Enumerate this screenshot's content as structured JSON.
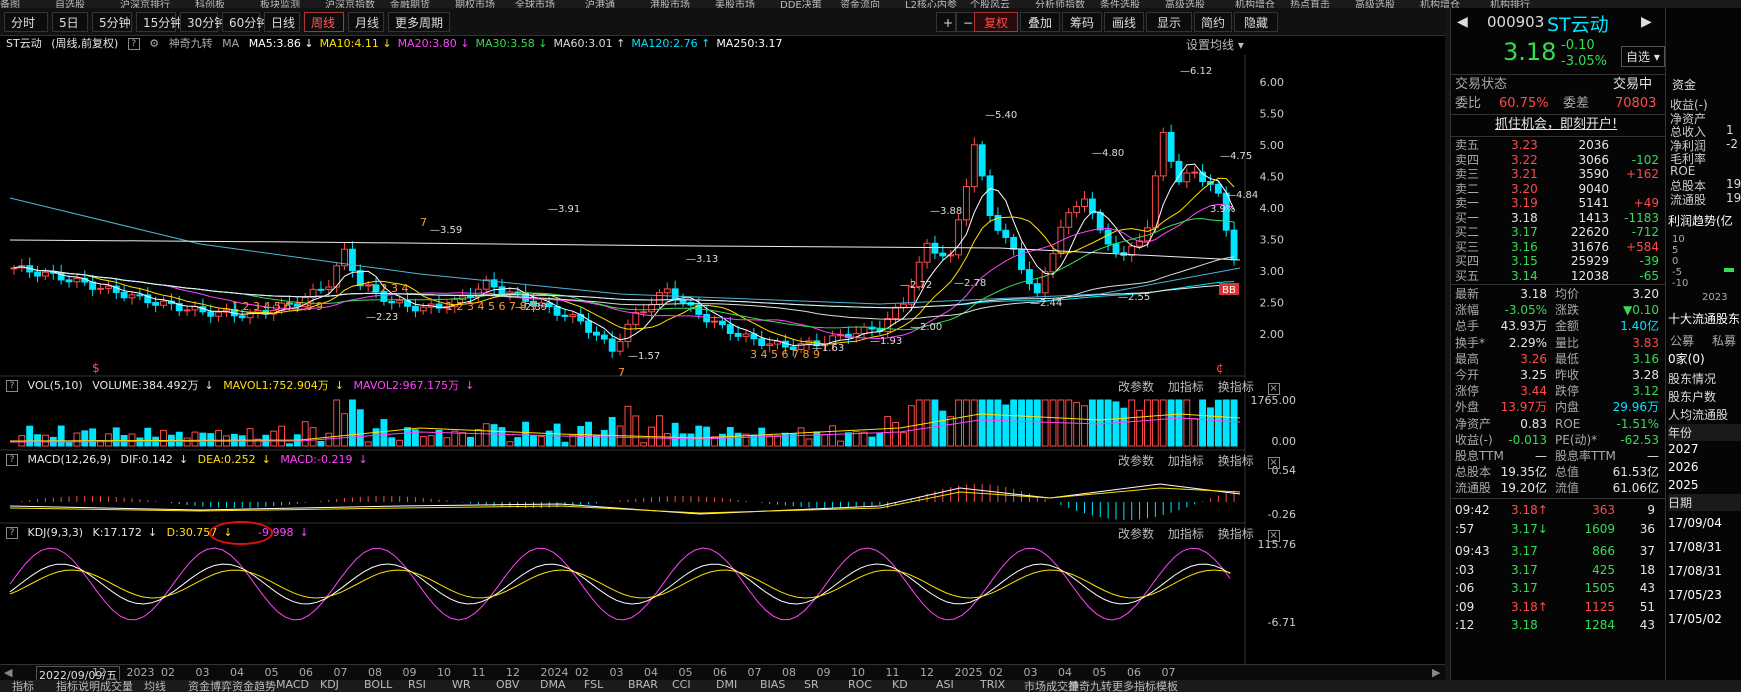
{
  "menubar": [
    "备图",
    "自选股",
    "沪深京排行",
    "科创板",
    "板块监测",
    "沪深京指数",
    "金融期货",
    "期权市场",
    "全球市场",
    "沪港通",
    "港股市场",
    "美股市场",
    "DDE决策",
    "资金流向",
    "L2核心内参",
    "个股风云",
    "分析师指数",
    "条件选股",
    "高级选股",
    "机构增仓",
    "热点直击",
    "高级选股",
    "机构增仓",
    "机构排行"
  ],
  "toolbar": {
    "periods": [
      "分时",
      "5日",
      "5分钟",
      "15分钟",
      "30分钟",
      "60分钟",
      "日线",
      "周线",
      "月线",
      "更多周期"
    ],
    "active_period": "周线",
    "right_buttons": [
      "+",
      "−",
      "复权",
      "叠加",
      "筹码",
      "画线",
      "显示",
      "简约",
      "隐藏"
    ]
  },
  "main_chart": {
    "stock_label": "ST云动",
    "mode_label": "(周线,前复权)",
    "indicator_label": "神奇九转",
    "ma_title": "MA",
    "ma": [
      {
        "label": "MA5:3.86",
        "color": "#ffffff",
        "dir": "↓"
      },
      {
        "label": "MA10:4.11",
        "color": "#ffe000",
        "dir": "↓"
      },
      {
        "label": "MA20:3.80",
        "color": "#ff44ff",
        "dir": "↓"
      },
      {
        "label": "MA30:3.58",
        "color": "#33dd55",
        "dir": "↓"
      },
      {
        "label": "MA60:3.01",
        "color": "#dddddd",
        "dir": "↑"
      },
      {
        "label": "MA120:2.76",
        "color": "#00e5ff",
        "dir": "↑"
      },
      {
        "label": "MA250:3.17",
        "color": "#ffffff",
        "dir": ""
      }
    ],
    "settings_label": "设置均线",
    "y_ticks": [
      "6.00",
      "5.50",
      "5.00",
      "4.50",
      "4.00",
      "3.50",
      "3.00",
      "2.50",
      "2.00"
    ],
    "price_tags": [
      "6.12",
      "5.40",
      "4.80",
      "4.75",
      "3.91",
      "3.88",
      "3.59",
      "3.13",
      "2.78",
      "2.72",
      "2.55",
      "2.44",
      "2.39",
      "2.23",
      "2.00",
      "1.93",
      "1.63",
      "1.57"
    ],
    "right_small_labels": [
      "4.84",
      "3.9%"
    ],
    "bb_badge": "BB",
    "markers": [
      "$",
      "¢"
    ]
  },
  "vol_panel": {
    "title": "VOL(5,10)",
    "volume": "VOLUME:384.492万",
    "mavol1": "MAVOL1:752.904万",
    "mavol2": "MAVOL2:967.175万",
    "y_top": "1765.00",
    "y_bottom": "0.00",
    "controls": [
      "改参数",
      "加指标",
      "换指标"
    ]
  },
  "macd_panel": {
    "title": "MACD(12,26,9)",
    "dif": "DIF:0.142",
    "dea": "DEA:0.252",
    "macd": "MACD:-0.219",
    "y_top": "0.54",
    "y_bottom": "-0.26",
    "controls": [
      "改参数",
      "加指标",
      "换指标"
    ]
  },
  "kdj_panel": {
    "title": "KDJ(9,3,3)",
    "k": "K:17.172",
    "d": "D:30.757",
    "j": "-9.998",
    "y_top": "115.76",
    "y_bottom": "-6.71",
    "controls": [
      "改参数",
      "加指标",
      "换指标"
    ]
  },
  "date_axis": [
    "2022/09/09/五",
    "12",
    "2023",
    "02",
    "03",
    "04",
    "05",
    "06",
    "07",
    "08",
    "09",
    "10",
    "11",
    "12",
    "2024",
    "02",
    "03",
    "04",
    "05",
    "06",
    "07",
    "08",
    "09",
    "10",
    "11",
    "12",
    "2025",
    "02",
    "03",
    "04",
    "05",
    "06",
    "07"
  ],
  "bottombar": [
    "指标",
    "指标说明",
    "成交量",
    "均线",
    "资金博弈",
    "资金趋势",
    "MACD",
    "KDJ",
    "BOLL",
    "RSI",
    "WR",
    "OBV",
    "DMA",
    "FSL",
    "BRAR",
    "CCI",
    "DMI",
    "BIAS",
    "SR",
    "ROC",
    "KD",
    "ASI",
    "TRIX",
    "市场成交量",
    "神奇九转",
    "更多指标",
    "模板"
  ],
  "quote": {
    "code": "000903",
    "name": "ST云动",
    "price": "3.18",
    "change": "-0.10",
    "change_pct": "-3.05%",
    "watch_label": "自选",
    "status_label": "交易状态",
    "status_value": "交易中",
    "webi_label": "委比",
    "webi_value": "60.75%",
    "weicha_label": "委差",
    "weicha_value": "70803",
    "promo": "抓住机会，即刻开户!",
    "asks": [
      {
        "label": "卖五",
        "price": "3.23",
        "vol": "2036",
        "chg": ""
      },
      {
        "label": "卖四",
        "price": "3.22",
        "vol": "3066",
        "chg": "-102"
      },
      {
        "label": "卖三",
        "price": "3.21",
        "vol": "3590",
        "chg": "+162"
      },
      {
        "label": "卖二",
        "price": "3.20",
        "vol": "9040",
        "chg": ""
      },
      {
        "label": "卖一",
        "price": "3.19",
        "vol": "5141",
        "chg": "+49"
      }
    ],
    "bids": [
      {
        "label": "买一",
        "price": "3.18",
        "vol": "1413",
        "chg": "-1183"
      },
      {
        "label": "买二",
        "price": "3.17",
        "vol": "22620",
        "chg": "-712"
      },
      {
        "label": "买三",
        "price": "3.16",
        "vol": "31676",
        "chg": "+584"
      },
      {
        "label": "买四",
        "price": "3.15",
        "vol": "25929",
        "chg": "-39"
      },
      {
        "label": "买五",
        "price": "3.14",
        "vol": "12038",
        "chg": "-65"
      }
    ],
    "stats": [
      [
        "最新",
        "3.18",
        "均价",
        "3.20"
      ],
      [
        "涨幅",
        "-3.05%",
        "涨跌",
        "▼0.10"
      ],
      [
        "总手",
        "43.93万",
        "金额",
        "1.40亿"
      ],
      [
        "换手*",
        "2.29%",
        "量比",
        "3.83"
      ],
      [
        "最高",
        "3.26",
        "最低",
        "3.16"
      ],
      [
        "今开",
        "3.25",
        "昨收",
        "3.28"
      ],
      [
        "涨停",
        "3.44",
        "跌停",
        "3.12"
      ],
      [
        "外盘",
        "13.97万",
        "内盘",
        "29.96万"
      ],
      [
        "净资产",
        "0.83",
        "ROE",
        "-1.51%"
      ],
      [
        "收益(-)",
        "-0.013",
        "PE(动)*",
        "-62.53"
      ],
      [
        "股息TTM",
        "—",
        "股息率TTM",
        "—"
      ],
      [
        "总股本",
        "19.35亿",
        "总值",
        "61.53亿"
      ],
      [
        "流通股",
        "19.20亿",
        "流值",
        "61.06亿"
      ]
    ],
    "ticks": [
      [
        "09:42",
        "3.18",
        "↑",
        "363",
        "9"
      ],
      [
        ":57",
        "3.17",
        "↓",
        "1609",
        "36"
      ],
      [
        "09:43",
        "3.17",
        "",
        "866",
        "37"
      ],
      [
        ":03",
        "3.17",
        "",
        "425",
        "18"
      ],
      [
        ":06",
        "3.17",
        "",
        "1505",
        "43"
      ],
      [
        ":09",
        "3.18",
        "↑",
        "1125",
        "51"
      ],
      [
        ":12",
        "3.18",
        "",
        "1284",
        "43"
      ]
    ]
  },
  "farright": {
    "tab": "资金",
    "items": [
      "收益(-)",
      "净资产",
      "总收入",
      "净利润",
      "毛利率",
      "ROE",
      "总股本",
      "流通股"
    ],
    "values": [
      "",
      "",
      "1",
      "-2",
      "",
      "",
      "19",
      "19"
    ],
    "trend_title": "利润趋势(亿",
    "trend_ticks": [
      "10",
      "5",
      "0",
      "-5",
      "-10"
    ],
    "trend_year": "2023",
    "top10": "十大流通股东",
    "fund_labels": [
      "公募",
      "私募"
    ],
    "fund_values": "0家(0)",
    "holder_items": [
      "股东情况",
      "股东户数",
      "人均流通股"
    ],
    "year_title": "年份",
    "years": [
      "2027",
      "2026",
      "2025"
    ],
    "date_title": "日期",
    "dates": [
      "17/09/04",
      "17/08/31",
      "17/08/31",
      "17/05/23",
      "17/05/02"
    ]
  }
}
